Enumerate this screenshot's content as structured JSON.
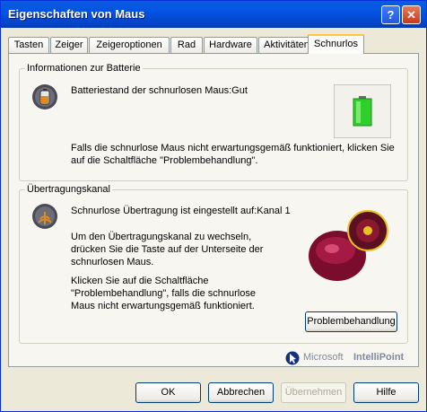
{
  "window": {
    "title": "Eigenschaften von Maus",
    "help_glyph": "?",
    "close_glyph": "✕"
  },
  "tabs": [
    {
      "label": "Tasten"
    },
    {
      "label": "Zeiger"
    },
    {
      "label": "Zeigeroptionen"
    },
    {
      "label": "Rad"
    },
    {
      "label": "Hardware"
    },
    {
      "label": "Aktivitäten"
    },
    {
      "label": "Schnurlos",
      "active": true
    }
  ],
  "battery": {
    "legend": "Informationen zur Batterie",
    "status": "Batteriestand der schnurlosen Maus:Gut",
    "info": "Falls die schnurlose Maus nicht erwartungsgemäß funktioniert, klicken Sie auf die Schaltfläche \"Problembehandlung\"."
  },
  "transmission": {
    "legend": "Übertragungskanal",
    "status": "Schnurlose Übertragung ist eingestellt auf:Kanal 1",
    "instruction": "Um den Übertragungskanal zu wechseln, drücken Sie die Taste auf der Unterseite der schnurlosen Maus.",
    "help": "Klicken Sie auf die Schaltfläche \"Problembehandlung\", falls die schnurlose Maus nicht erwartungsgemäß funktioniert.",
    "troubleshoot_button": "Problembehandlung"
  },
  "branding": {
    "company": "Microsoft",
    "product": "IntelliPoint"
  },
  "buttons": {
    "ok": "OK",
    "cancel": "Abbrechen",
    "apply": "Übernehmen",
    "help": "Hilfe"
  },
  "colors": {
    "title_bar": "#0453e4",
    "tab_highlight": "#ffc83c",
    "battery_green": "#2fcf2a"
  }
}
